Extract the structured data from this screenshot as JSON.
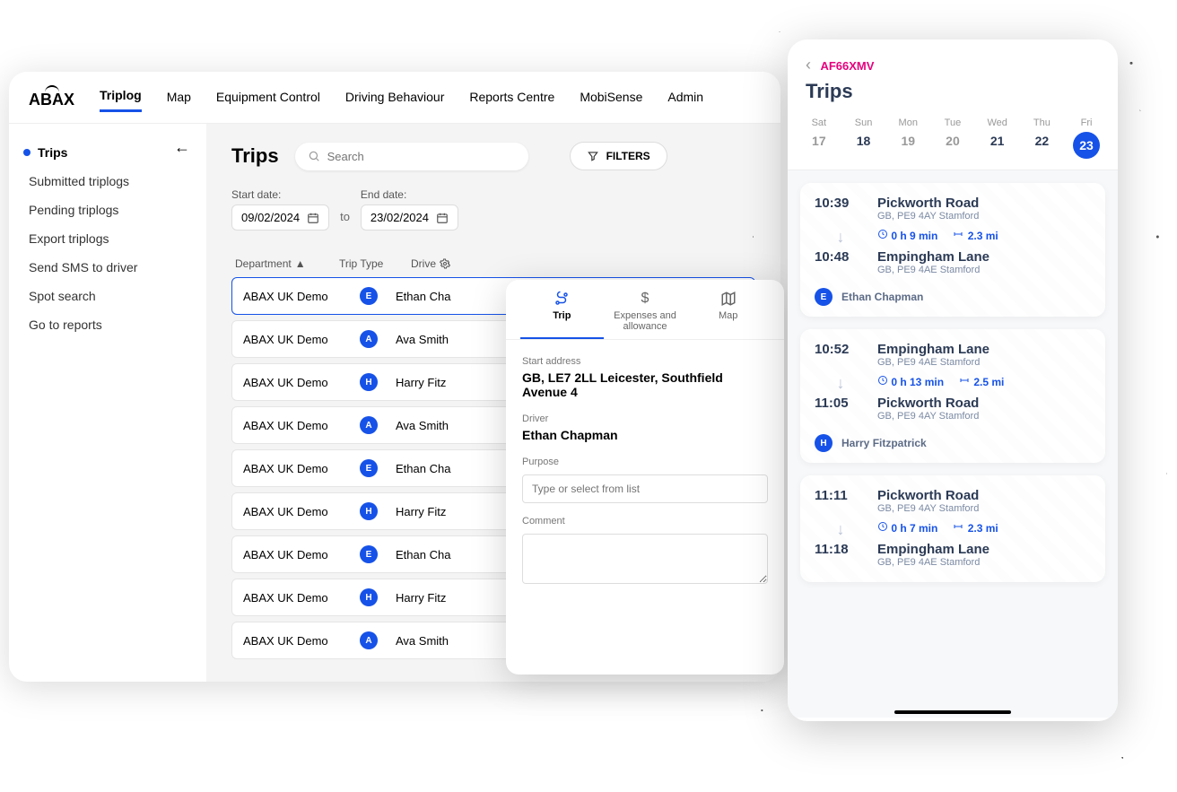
{
  "brand": "ABAX",
  "nav": {
    "items": [
      "Triplog",
      "Map",
      "Equipment Control",
      "Driving Behaviour",
      "Reports Centre",
      "MobiSense",
      "Admin"
    ],
    "active": "Triplog"
  },
  "sidebar": {
    "items": [
      "Trips",
      "Submitted triplogs",
      "Pending triplogs",
      "Export triplogs",
      "Send SMS to driver",
      "Spot search",
      "Go to reports"
    ],
    "active": "Trips"
  },
  "trips": {
    "title": "Trips",
    "search_placeholder": "Search",
    "filters_label": "FILTERS",
    "start_date_label": "Start date:",
    "end_date_label": "End date:",
    "to_label": "to",
    "start_date": "09/02/2024",
    "end_date": "23/02/2024",
    "headers": {
      "department": "Department",
      "trip_type": "Trip Type",
      "driver": "Drive"
    },
    "rows": [
      {
        "department": "ABAX UK Demo",
        "badge": "E",
        "driver": "Ethan Cha",
        "selected": true
      },
      {
        "department": "ABAX UK Demo",
        "badge": "A",
        "driver": "Ava Smith"
      },
      {
        "department": "ABAX UK Demo",
        "badge": "H",
        "driver": "Harry Fitz"
      },
      {
        "department": "ABAX UK Demo",
        "badge": "A",
        "driver": "Ava Smith"
      },
      {
        "department": "ABAX UK Demo",
        "badge": "E",
        "driver": "Ethan Cha"
      },
      {
        "department": "ABAX UK Demo",
        "badge": "H",
        "driver": "Harry Fitz"
      },
      {
        "department": "ABAX UK Demo",
        "badge": "E",
        "driver": "Ethan Cha"
      },
      {
        "department": "ABAX UK Demo",
        "badge": "H",
        "driver": "Harry Fitz"
      },
      {
        "department": "ABAX UK Demo",
        "badge": "A",
        "driver": "Ava Smith"
      }
    ]
  },
  "popover": {
    "tabs": {
      "trip": "Trip",
      "expenses": "Expenses and allowance",
      "map": "Map"
    },
    "start_address_label": "Start address",
    "start_address": "GB, LE7 2LL Leicester, Southfield Avenue 4",
    "driver_label": "Driver",
    "driver": "Ethan Chapman",
    "purpose_label": "Purpose",
    "purpose_placeholder": "Type or select from list",
    "comment_label": "Comment"
  },
  "mobile": {
    "plate": "AF66XMV",
    "title": "Trips",
    "days": [
      {
        "dow": "Sat",
        "num": "17"
      },
      {
        "dow": "Sun",
        "num": "18",
        "avail": true
      },
      {
        "dow": "Mon",
        "num": "19"
      },
      {
        "dow": "Tue",
        "num": "20"
      },
      {
        "dow": "Wed",
        "num": "21",
        "avail": true
      },
      {
        "dow": "Thu",
        "num": "22",
        "avail": true
      },
      {
        "dow": "Fri",
        "num": "23",
        "sel": true
      }
    ],
    "cards": [
      {
        "t1": "10:39",
        "p1": "Pickworth Road",
        "a1": "GB, PE9 4AY Stamford",
        "dur": "0 h 9 min",
        "dist": "2.3 mi",
        "t2": "10:48",
        "p2": "Empingham Lane",
        "a2": "GB, PE9 4AE Stamford",
        "badge": "E",
        "driver": "Ethan Chapman"
      },
      {
        "t1": "10:52",
        "p1": "Empingham Lane",
        "a1": "GB, PE9 4AE Stamford",
        "dur": "0 h 13 min",
        "dist": "2.5 mi",
        "t2": "11:05",
        "p2": "Pickworth Road",
        "a2": "GB, PE9 4AY Stamford",
        "badge": "H",
        "driver": "Harry Fitzpatrick"
      },
      {
        "t1": "11:11",
        "p1": "Pickworth Road",
        "a1": "GB, PE9 4AY Stamford",
        "dur": "0 h 7 min",
        "dist": "2.3 mi",
        "t2": "11:18",
        "p2": "Empingham Lane",
        "a2": "GB, PE9 4AE Stamford",
        "badge": "",
        "driver": ""
      }
    ]
  }
}
